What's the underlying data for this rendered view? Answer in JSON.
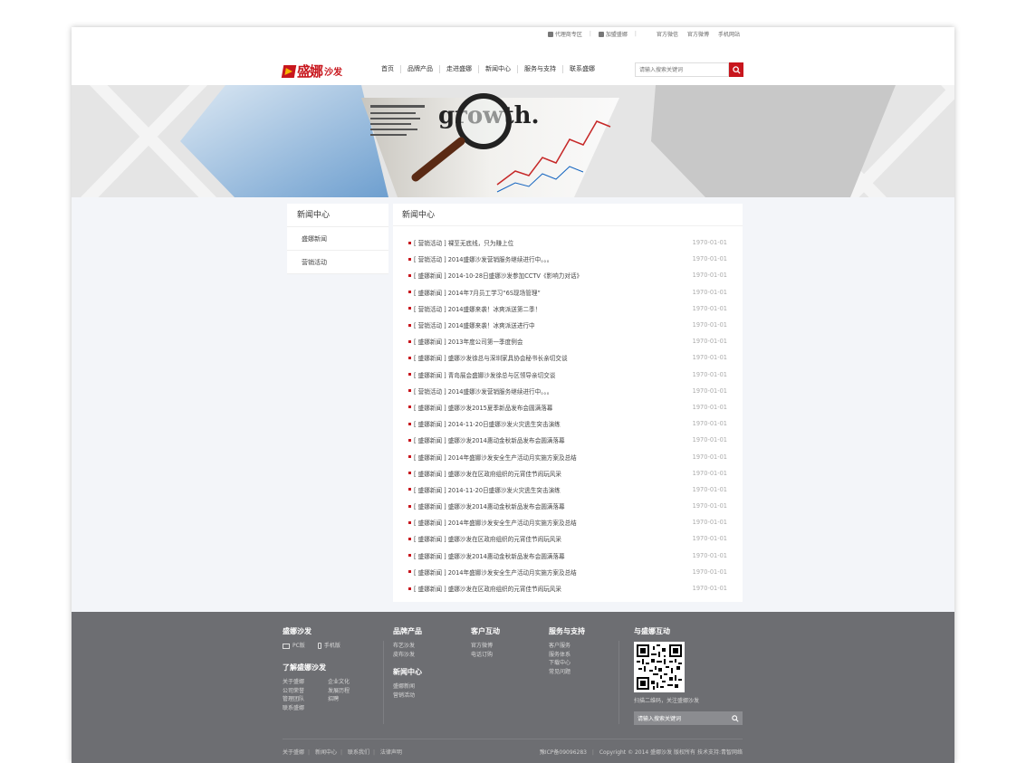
{
  "header": {
    "top_links": {
      "agent": "代理商专区",
      "join": "加盟盛娜",
      "wechat": "官方微信",
      "weibo": "官方微博",
      "mobile": "手机网站"
    },
    "logo": {
      "name": "盛娜",
      "sub": "沙发"
    },
    "nav": [
      "首页",
      "品牌产品",
      "走进盛娜",
      "新闻中心",
      "服务与支持",
      "联系盛娜"
    ],
    "search_placeholder": "请输入搜索关键词"
  },
  "sidebar": {
    "title": "新闻中心",
    "items": [
      "盛娜新闻",
      "营销活动"
    ]
  },
  "main": {
    "title": "新闻中心",
    "news": [
      {
        "tag": "[ 营销活动 ]",
        "title": "裸至无底线，只为赚上位",
        "date": "1970-01-01"
      },
      {
        "tag": "[ 营销活动 ]",
        "title": "2014盛娜沙发营销服务继续进行中。。。",
        "date": "1970-01-01"
      },
      {
        "tag": "[ 盛娜新闻 ]",
        "title": "2014-10-28日盛娜沙发参加CCTV《影响力对话》",
        "date": "1970-01-01"
      },
      {
        "tag": "[ 盛娜新闻 ]",
        "title": "2014年7月员工学习“6S现场管理”",
        "date": "1970-01-01"
      },
      {
        "tag": "[ 营销活动 ]",
        "title": "2014盛娜来袭！冰爽派送第二季！",
        "date": "1970-01-01"
      },
      {
        "tag": "[ 营销活动 ]",
        "title": "2014盛娜来袭！冰爽派送进行中",
        "date": "1970-01-01"
      },
      {
        "tag": "[ 盛娜新闻 ]",
        "title": "2013年度公司第一季度例会",
        "date": "1970-01-01"
      },
      {
        "tag": "[ 盛娜新闻 ]",
        "title": "盛娜沙发徐总与深圳家具协会秘书长亲切交谈",
        "date": "1970-01-01"
      },
      {
        "tag": "[ 盛娜新闻 ]",
        "title": "青岛展会盛娜沙发徐总与区领导亲切交谈",
        "date": "1970-01-01"
      },
      {
        "tag": "[ 营销活动 ]",
        "title": "2014盛娜沙发营销服务继续进行中。。。",
        "date": "1970-01-01"
      },
      {
        "tag": "[ 盛娜新闻 ]",
        "title": "盛娜沙发2015夏季新品发布会圆满落幕",
        "date": "1970-01-01"
      },
      {
        "tag": "[ 盛娜新闻 ]",
        "title": "2014-11-20日盛娜沙发火灾逃生突击演练",
        "date": "1970-01-01"
      },
      {
        "tag": "[ 盛娜新闻 ]",
        "title": "盛娜沙发2014惠动金秋新品发布会圆满落幕",
        "date": "1970-01-01"
      },
      {
        "tag": "[ 盛娜新闻 ]",
        "title": "2014年盛娜沙发安全生产活动月实施方案及总结",
        "date": "1970-01-01"
      },
      {
        "tag": "[ 盛娜新闻 ]",
        "title": "盛娜沙发在区政府组织的元宵佳节闹玩风采",
        "date": "1970-01-01"
      },
      {
        "tag": "[ 盛娜新闻 ]",
        "title": "2014-11-20日盛娜沙发火灾逃生突击演练",
        "date": "1970-01-01"
      },
      {
        "tag": "[ 盛娜新闻 ]",
        "title": "盛娜沙发2014惠动金秋新品发布会圆满落幕",
        "date": "1970-01-01"
      },
      {
        "tag": "[ 盛娜新闻 ]",
        "title": "2014年盛娜沙发安全生产活动月实施方案及总结",
        "date": "1970-01-01"
      },
      {
        "tag": "[ 盛娜新闻 ]",
        "title": "盛娜沙发在区政府组织的元宵佳节闹玩风采",
        "date": "1970-01-01"
      },
      {
        "tag": "[ 盛娜新闻 ]",
        "title": "盛娜沙发2014惠动金秋新品发布会圆满落幕",
        "date": "1970-01-01"
      },
      {
        "tag": "[ 盛娜新闻 ]",
        "title": "2014年盛娜沙发安全生产活动月实施方案及总结",
        "date": "1970-01-01"
      },
      {
        "tag": "[ 盛娜新闻 ]",
        "title": "盛娜沙发在区政府组织的元宵佳节闹玩风采",
        "date": "1970-01-01"
      }
    ]
  },
  "footer": {
    "brand": {
      "title": "盛娜沙发",
      "pc": "PC版",
      "mobile": "手机版"
    },
    "about": {
      "title": "了解盛娜沙发",
      "links": [
        "关于盛娜",
        "企业文化",
        "公司荣誉",
        "发展历程",
        "管理团队",
        "招聘",
        "联系盛娜"
      ]
    },
    "products": {
      "title": "品牌产品",
      "links": [
        "布艺沙发",
        "皮布沙发"
      ]
    },
    "news": {
      "title": "新闻中心",
      "links": [
        "盛娜新闻",
        "营销活动"
      ]
    },
    "interact": {
      "title": "客户互动",
      "links": [
        "官方微博",
        "电话订购"
      ]
    },
    "service": {
      "title": "服务与支持",
      "links": [
        "客户服务",
        "服务体系",
        "下载中心",
        "常见问题"
      ]
    },
    "qr": {
      "title": "与盛娜互动",
      "caption": "扫描二维码，关注盛娜沙发"
    },
    "search_placeholder": "请输入搜索关键词",
    "bottom_links": [
      "关于盛娜",
      "新闻中心",
      "联系我们",
      "法律声明"
    ],
    "icp": "豫ICP备09096283",
    "copyright": "Copyright © 2014 盛娜沙发 版权所有 技术支持:青智网络"
  },
  "colors": {
    "accent": "#c8161d",
    "footer_bg": "#6d6e72"
  }
}
